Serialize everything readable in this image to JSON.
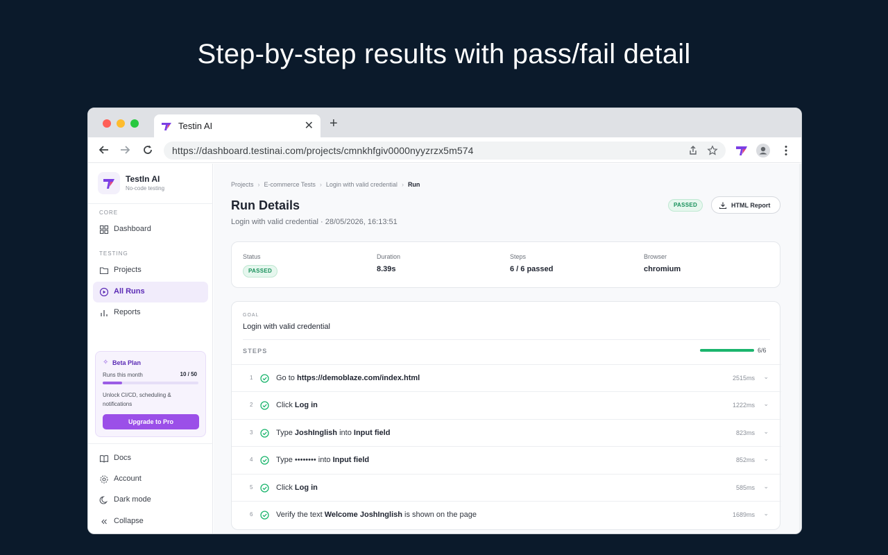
{
  "hero_title": "Step-by-step results with pass/fail detail",
  "browser": {
    "tab_title": "Testin AI",
    "tab_close": "✕",
    "new_tab": "+",
    "url": "https://dashboard.testinai.com/projects/cmnkhfgiv0000nyyzrzx5m574"
  },
  "sidebar": {
    "brand_name": "TestIn AI",
    "brand_sub": "No-code testing",
    "core_label": "CORE",
    "testing_label": "TESTING",
    "items": [
      {
        "label": "Dashboard",
        "icon": "dashboard-icon"
      },
      {
        "label": "Projects",
        "icon": "folder-icon"
      },
      {
        "label": "All Runs",
        "icon": "play-circle-icon",
        "active": true
      },
      {
        "label": "Reports",
        "icon": "bar-chart-icon"
      }
    ],
    "bottom_items": [
      {
        "label": "Docs",
        "icon": "book-icon"
      },
      {
        "label": "Account",
        "icon": "gear-icon"
      },
      {
        "label": "Dark mode",
        "icon": "moon-icon"
      },
      {
        "label": "Collapse",
        "icon": "chevrons-left-icon"
      }
    ],
    "beta": {
      "title": "Beta Plan",
      "runs_label": "Runs this month",
      "runs_count": "10 / 50",
      "runs_fraction": 0.2,
      "description": "Unlock CI/CD, scheduling & notifications",
      "button": "Upgrade to Pro"
    }
  },
  "main": {
    "breadcrumbs": [
      "Projects",
      "E-commerce Tests",
      "Login with valid credential",
      "Run"
    ],
    "title": "Run Details",
    "subtitle": "Login with valid credential · 28/05/2026, 16:13:51",
    "status_badge": "PASSED",
    "report_button": "HTML Report",
    "stats": [
      {
        "label": "Status",
        "value": "PASSED",
        "badge": true
      },
      {
        "label": "Duration",
        "value": "8.39s"
      },
      {
        "label": "Steps",
        "value": "6 / 6 passed"
      },
      {
        "label": "Browser",
        "value": "chromium"
      }
    ],
    "goal_label": "GOAL",
    "goal": "Login with valid credential",
    "steps_label": "STEPS",
    "steps_count": "6/6",
    "steps_fraction": 1.0,
    "steps": [
      {
        "num": "1",
        "parts": [
          [
            "Go to ",
            false
          ],
          [
            "https://demoblaze.com/index.html",
            true
          ]
        ],
        "duration": "2515ms"
      },
      {
        "num": "2",
        "parts": [
          [
            "Click ",
            false
          ],
          [
            "Log in",
            true
          ]
        ],
        "duration": "1222ms"
      },
      {
        "num": "3",
        "parts": [
          [
            "Type ",
            false
          ],
          [
            "JoshInglish",
            true
          ],
          [
            " into ",
            false
          ],
          [
            "Input field",
            true
          ]
        ],
        "duration": "823ms"
      },
      {
        "num": "4",
        "parts": [
          [
            "Type ",
            false
          ],
          [
            "••••••••",
            false
          ],
          [
            " into ",
            false
          ],
          [
            "Input field",
            true
          ]
        ],
        "duration": "852ms"
      },
      {
        "num": "5",
        "parts": [
          [
            "Click ",
            false
          ],
          [
            "Log in",
            true
          ]
        ],
        "duration": "585ms"
      },
      {
        "num": "6",
        "parts": [
          [
            "Verify the text ",
            false
          ],
          [
            "Welcome JoshInglish",
            true
          ],
          [
            " is shown on the page",
            false
          ]
        ],
        "duration": "1689ms"
      }
    ]
  },
  "colors": {
    "accent": "#9b4fe8",
    "success": "#1bb56d",
    "background": "#0b1a2b"
  }
}
